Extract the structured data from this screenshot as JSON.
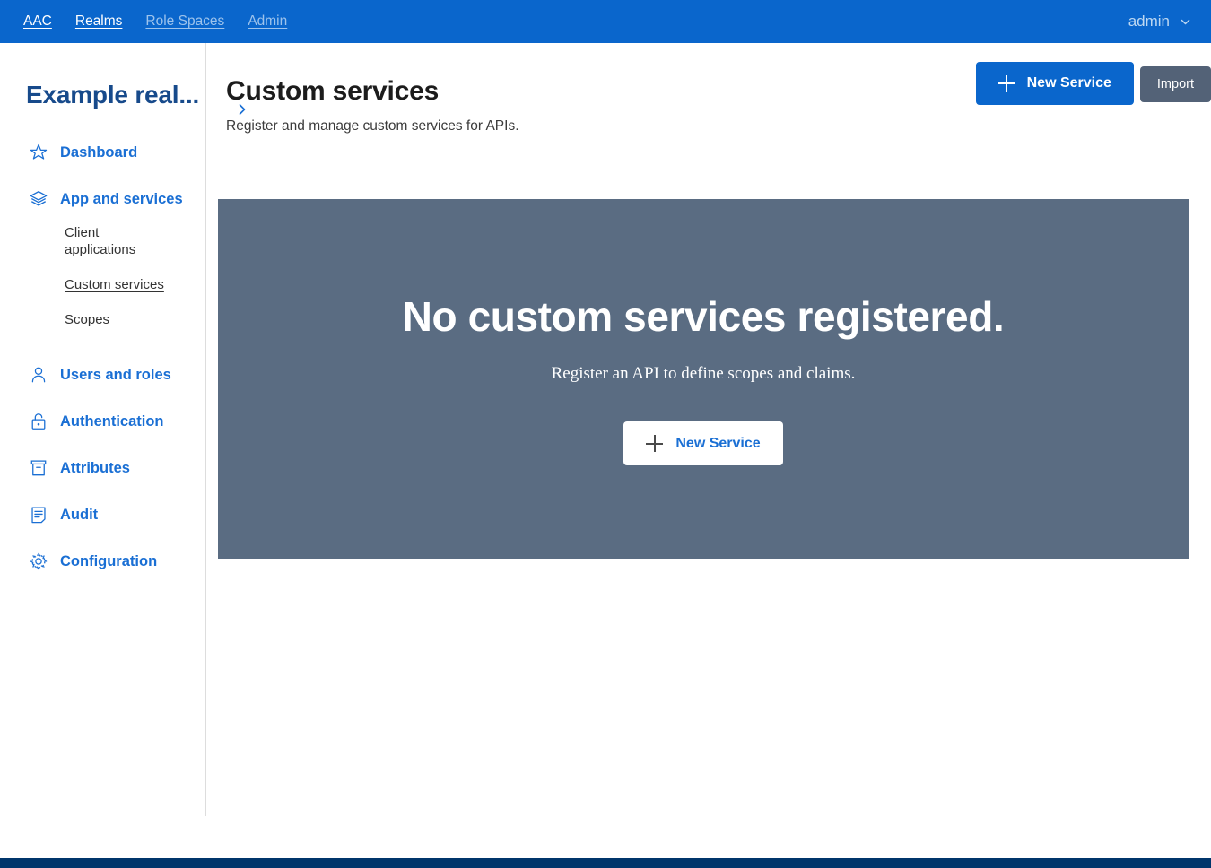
{
  "topbar": {
    "links": [
      {
        "label": "AAC",
        "dim": false
      },
      {
        "label": "Realms",
        "dim": false
      },
      {
        "label": "Role Spaces",
        "dim": true
      },
      {
        "label": "Admin",
        "dim": true
      }
    ],
    "user": "admin",
    "user_chevron_icon": "chevron-down-icon",
    "background": "#0a66cc"
  },
  "sidebar": {
    "realm_title": "Example real...",
    "items": [
      {
        "label": "Dashboard",
        "icon": "star-icon"
      },
      {
        "label": "App and services",
        "icon": "layers-icon"
      },
      {
        "label": "Users and roles",
        "icon": "user-icon"
      },
      {
        "label": "Authentication",
        "icon": "lock-icon"
      },
      {
        "label": "Attributes",
        "icon": "archive-box-icon"
      },
      {
        "label": "Audit",
        "icon": "document-lines-icon"
      },
      {
        "label": "Configuration",
        "icon": "gear-icon"
      }
    ],
    "subitems": [
      {
        "label": "Client applications",
        "active": false
      },
      {
        "label": "Custom services",
        "active": true
      },
      {
        "label": "Scopes",
        "active": false
      }
    ],
    "link_color": "#1a6fd4",
    "title_color": "#174a8b"
  },
  "main": {
    "page_title": "Custom services",
    "page_subtitle": "Register and manage custom services for APIs.",
    "breadcrumb_chevron_icon": "chevron-right-icon",
    "actions": {
      "new_service_label": "New Service",
      "new_service_icon": "plus-icon",
      "import_label": "Import",
      "primary_color": "#0a66cc",
      "secondary_color": "#536277"
    },
    "empty_state": {
      "title": "No custom services registered.",
      "subtitle": "Register an API to define scopes and claims.",
      "button_label": "New Service",
      "button_icon": "plus-icon",
      "background": "#5a6c82"
    }
  },
  "footer": {
    "color": "#00356b"
  }
}
